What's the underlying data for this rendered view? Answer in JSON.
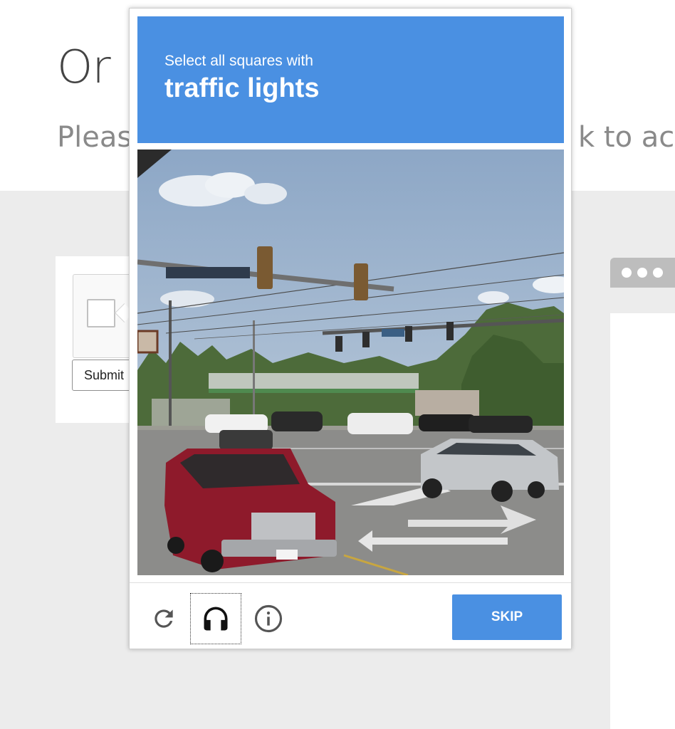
{
  "background": {
    "heading": "Or",
    "subtitle_left": "Pleas",
    "subtitle_right": "k to acce",
    "submit_label": "Submit"
  },
  "captcha": {
    "instruction": "Select all squares with",
    "target": "traffic lights",
    "grid": {
      "rows": 4,
      "columns": 4
    },
    "skip_label": "SKIP",
    "icons": [
      "reload-icon",
      "headphones-icon",
      "info-icon"
    ]
  },
  "colors": {
    "accent": "#4a90e2",
    "page_gray": "#ececec",
    "heading_text": "#444444",
    "subtitle_text": "#8a8a8a"
  }
}
